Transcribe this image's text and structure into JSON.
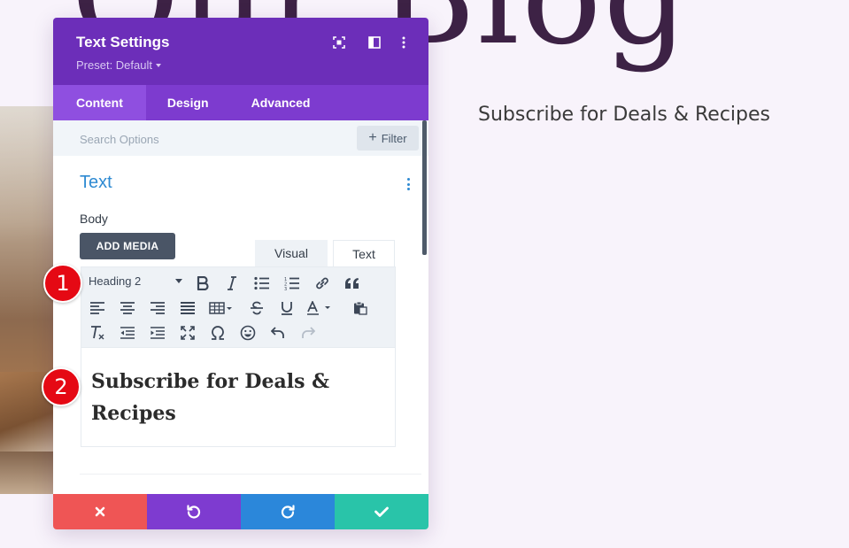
{
  "background": {
    "page_title": "Our Blog",
    "subscribe_text": "Subscribe for Deals & Recipes"
  },
  "modal": {
    "title": "Text Settings",
    "preset": "Preset: Default",
    "header_icons": [
      "expand-icon",
      "split-view-icon",
      "more-vertical-icon"
    ],
    "tabs": [
      {
        "label": "Content",
        "active": true
      },
      {
        "label": "Design",
        "active": false
      },
      {
        "label": "Advanced",
        "active": false
      }
    ],
    "search": {
      "placeholder": "Search Options",
      "value": ""
    },
    "filter_label": "Filter",
    "section_title": "Text",
    "body_label": "Body",
    "add_media_label": "ADD MEDIA",
    "editor_tabs": {
      "visual": "Visual",
      "text": "Text"
    },
    "toolbar": {
      "heading_select": "Heading 2",
      "row1": [
        "bold-icon",
        "italic-icon",
        "bullet-list-icon",
        "numbered-list-icon",
        "link-icon",
        "blockquote-icon"
      ],
      "row2": [
        "align-left-icon",
        "align-center-icon",
        "align-right-icon",
        "align-justify-icon",
        "table-icon",
        "strikethrough-icon",
        "underline-icon",
        "text-color-icon",
        "paste-icon"
      ],
      "row3": [
        "clear-format-icon",
        "outdent-icon",
        "indent-icon",
        "fullscreen-icon",
        "omega-icon",
        "emoji-icon",
        "undo-icon",
        "redo-icon"
      ]
    },
    "content_heading": "Subscribe for Deals & Recipes"
  },
  "footer_icons": [
    "close-icon",
    "undo-icon",
    "redo-icon",
    "check-icon"
  ],
  "callouts": {
    "one": "1",
    "two": "2"
  },
  "colors": {
    "header_purple": "#6c2eb9",
    "tab_bar_purple": "#7d3bcf",
    "active_tab": "#8f4fe0",
    "section_blue": "#2e8ad2",
    "cancel_red": "#ef5555",
    "undo_purple": "#7e3bd0",
    "redo_blue": "#2b87da",
    "save_teal": "#29c4a9",
    "callout_red": "#e50914"
  }
}
